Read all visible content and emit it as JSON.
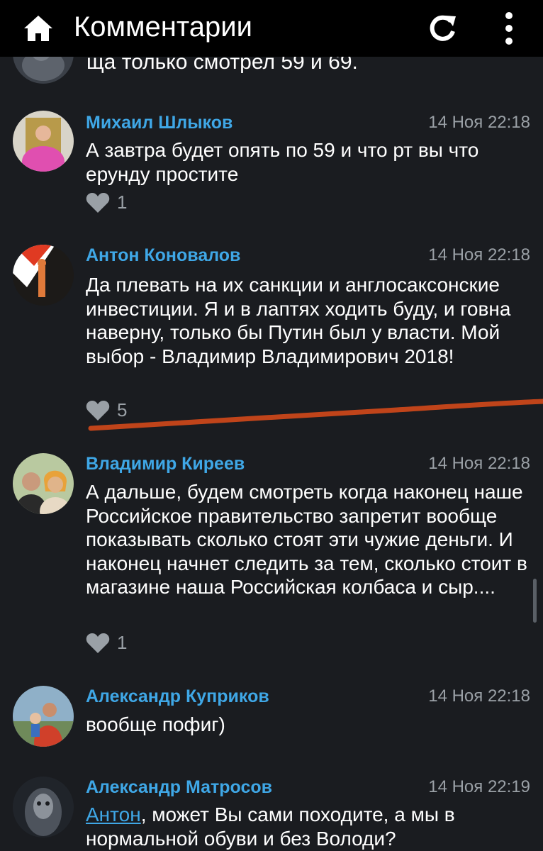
{
  "header": {
    "title": "Комментарии",
    "icons": [
      "home-icon",
      "refresh-icon",
      "more-vert-icon"
    ]
  },
  "partial_comment_text": "ща только смотрел 59 и 69.",
  "comments": [
    {
      "author": "Михаил Шлыков",
      "time": "14 Ноя 22:18",
      "text": "А завтра будет опять по 59 и что рт вы что ерунду простите",
      "likes": "1"
    },
    {
      "author": "Антон Коновалов",
      "time": "14 Ноя 22:18",
      "text": "Да плевать на их санкции и англосаксонские инвестиции. Я и в лаптях ходить буду, и говна наверну, только бы Путин был у власти. Мой выбор - Владимир Владимирович 2018!",
      "likes": "5"
    },
    {
      "author": "Владимир Киреев",
      "time": "14 Ноя 22:18",
      "text": "А дальше, будем смотреть когда наконец наше Российское правительство запретит вообще показывать сколько стоят эти чужие деньги. И наконец начнет следить за тем, сколько стоит в магазине наша Российская колбаса и сыр....",
      "likes": "1"
    },
    {
      "author": "Александр Куприков",
      "time": "14 Ноя 22:18",
      "text": "вообще пофиг)"
    },
    {
      "author": "Александр Матросов",
      "time": "14 Ноя 22:19",
      "mention": "Антон",
      "text": ", может Вы сами походите, а мы в нормальной обуви и без Володи?"
    }
  ],
  "colors": {
    "background": "#1a1c20",
    "topbar": "#000000",
    "author_link": "#3fa7e6",
    "meta_gray": "#9aa0a6",
    "annotation_underline": "#c0441a"
  }
}
